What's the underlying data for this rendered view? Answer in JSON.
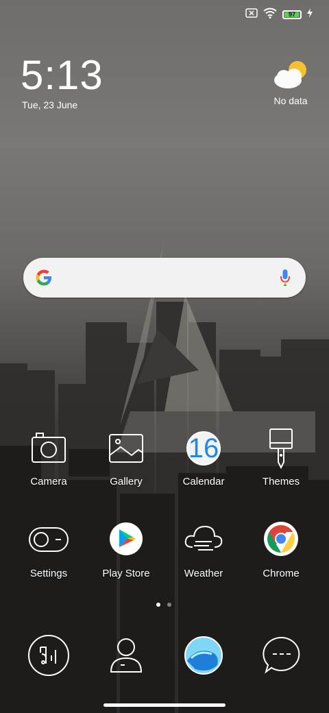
{
  "status_bar": {
    "battery_level": "97",
    "battery_fraction": 0.97,
    "icons": [
      "sim-x-icon",
      "wifi-icon",
      "battery-icon",
      "charging-icon"
    ]
  },
  "clock": {
    "time": "5:13",
    "date": "Tue, 23 June"
  },
  "weather": {
    "label": "No data",
    "icon": "cloud-sun-icon"
  },
  "search": {
    "icons": [
      "google-g-icon",
      "microphone-icon"
    ]
  },
  "apps": {
    "row1": [
      {
        "label": "Camera",
        "icon": "camera-icon"
      },
      {
        "label": "Gallery",
        "icon": "gallery-icon"
      },
      {
        "label": "Calendar",
        "icon": "calendar-icon",
        "day": "16"
      },
      {
        "label": "Themes",
        "icon": "themes-icon"
      }
    ],
    "row2": [
      {
        "label": "Settings",
        "icon": "settings-icon"
      },
      {
        "label": "Play Store",
        "icon": "play-store-icon"
      },
      {
        "label": "Weather",
        "icon": "weather-icon"
      },
      {
        "label": "Chrome",
        "icon": "chrome-icon"
      }
    ],
    "dock": [
      {
        "icon": "phone-icon"
      },
      {
        "icon": "contacts-icon"
      },
      {
        "icon": "browser-icon"
      },
      {
        "icon": "messages-icon"
      }
    ]
  },
  "pager": {
    "pages": 2,
    "current": 1
  },
  "colors": {
    "battery_green": "#5bd14a",
    "calendar_blue": "#1e88e5"
  }
}
